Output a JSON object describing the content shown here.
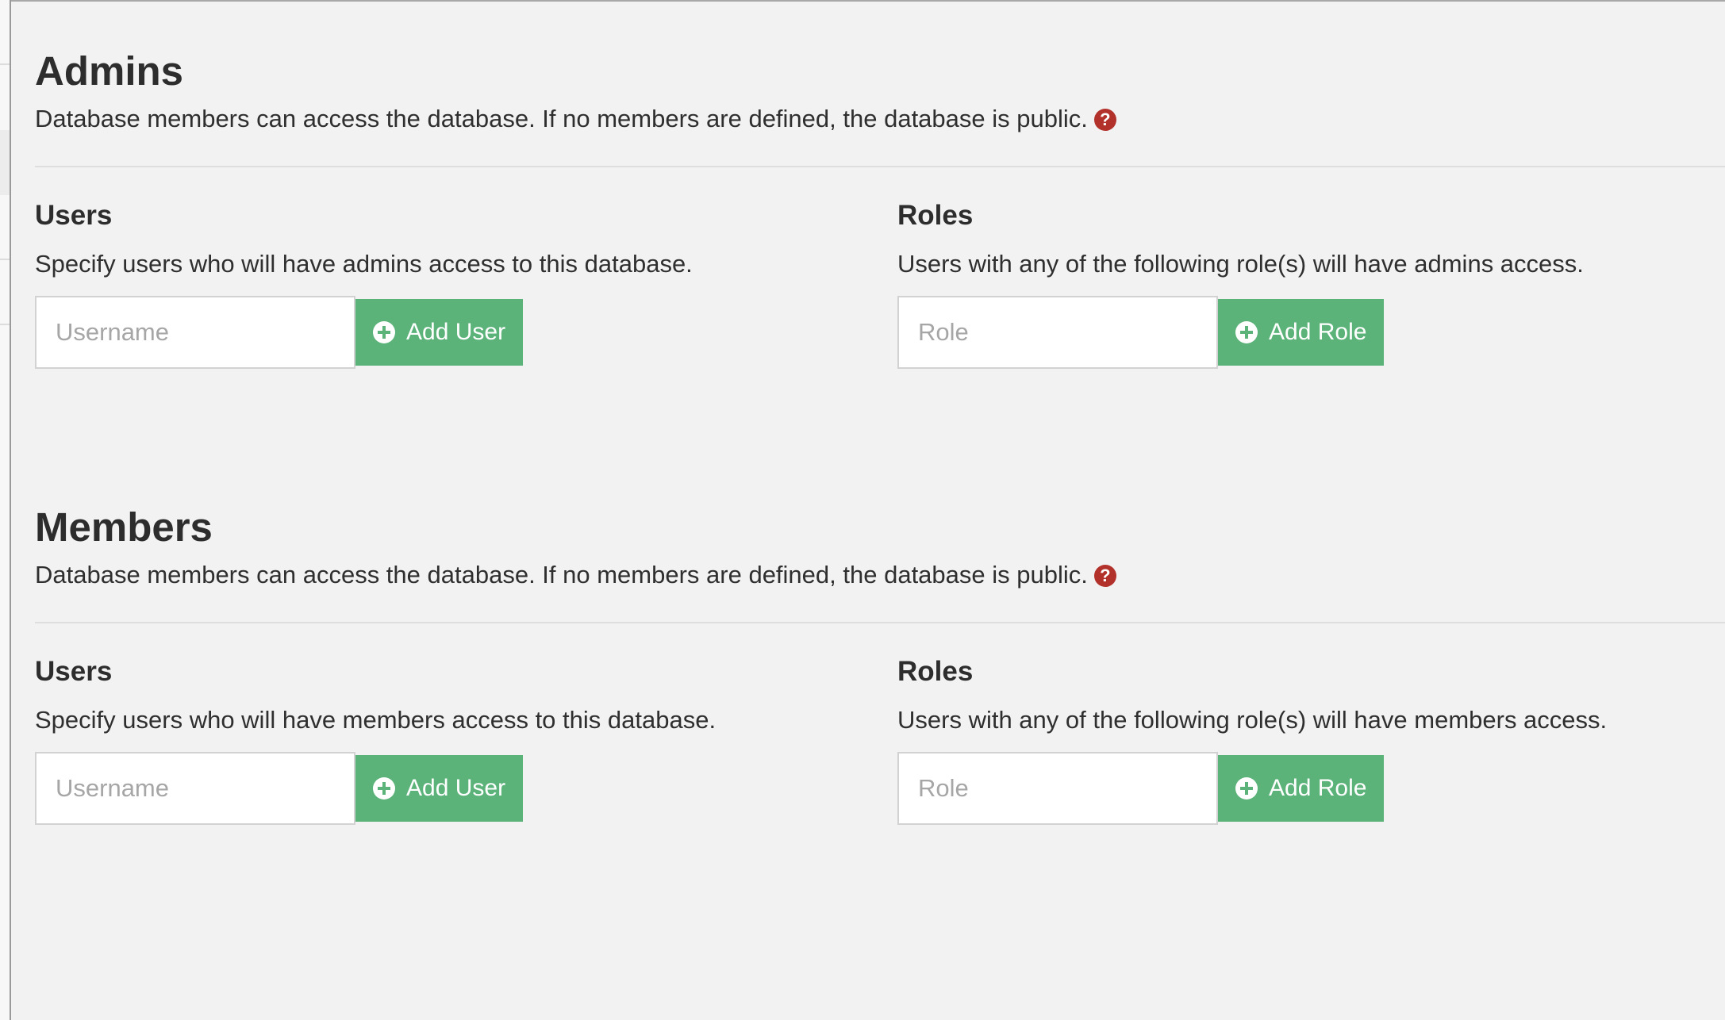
{
  "theme": {
    "accent": "#5bb37a",
    "help_icon_color": "#b3312b",
    "background": "#f2f2f2"
  },
  "sections": [
    {
      "title": "Admins",
      "description": "Database members can access the database. If no members are defined, the database is public.",
      "help_icon": "question-circle-icon",
      "users": {
        "title": "Users",
        "description": "Specify users who will have admins access to this database.",
        "input_placeholder": "Username",
        "button_label": "Add User",
        "button_icon": "plus-circle-icon"
      },
      "roles": {
        "title": "Roles",
        "description": "Users with any of the following role(s) will have admins access.",
        "input_placeholder": "Role",
        "button_label": "Add Role",
        "button_icon": "plus-circle-icon"
      }
    },
    {
      "title": "Members",
      "description": "Database members can access the database. If no members are defined, the database is public.",
      "help_icon": "question-circle-icon",
      "users": {
        "title": "Users",
        "description": "Specify users who will have members access to this database.",
        "input_placeholder": "Username",
        "button_label": "Add User",
        "button_icon": "plus-circle-icon"
      },
      "roles": {
        "title": "Roles",
        "description": "Users with any of the following role(s) will have members access.",
        "input_placeholder": "Role",
        "button_label": "Add Role",
        "button_icon": "plus-circle-icon"
      }
    }
  ]
}
